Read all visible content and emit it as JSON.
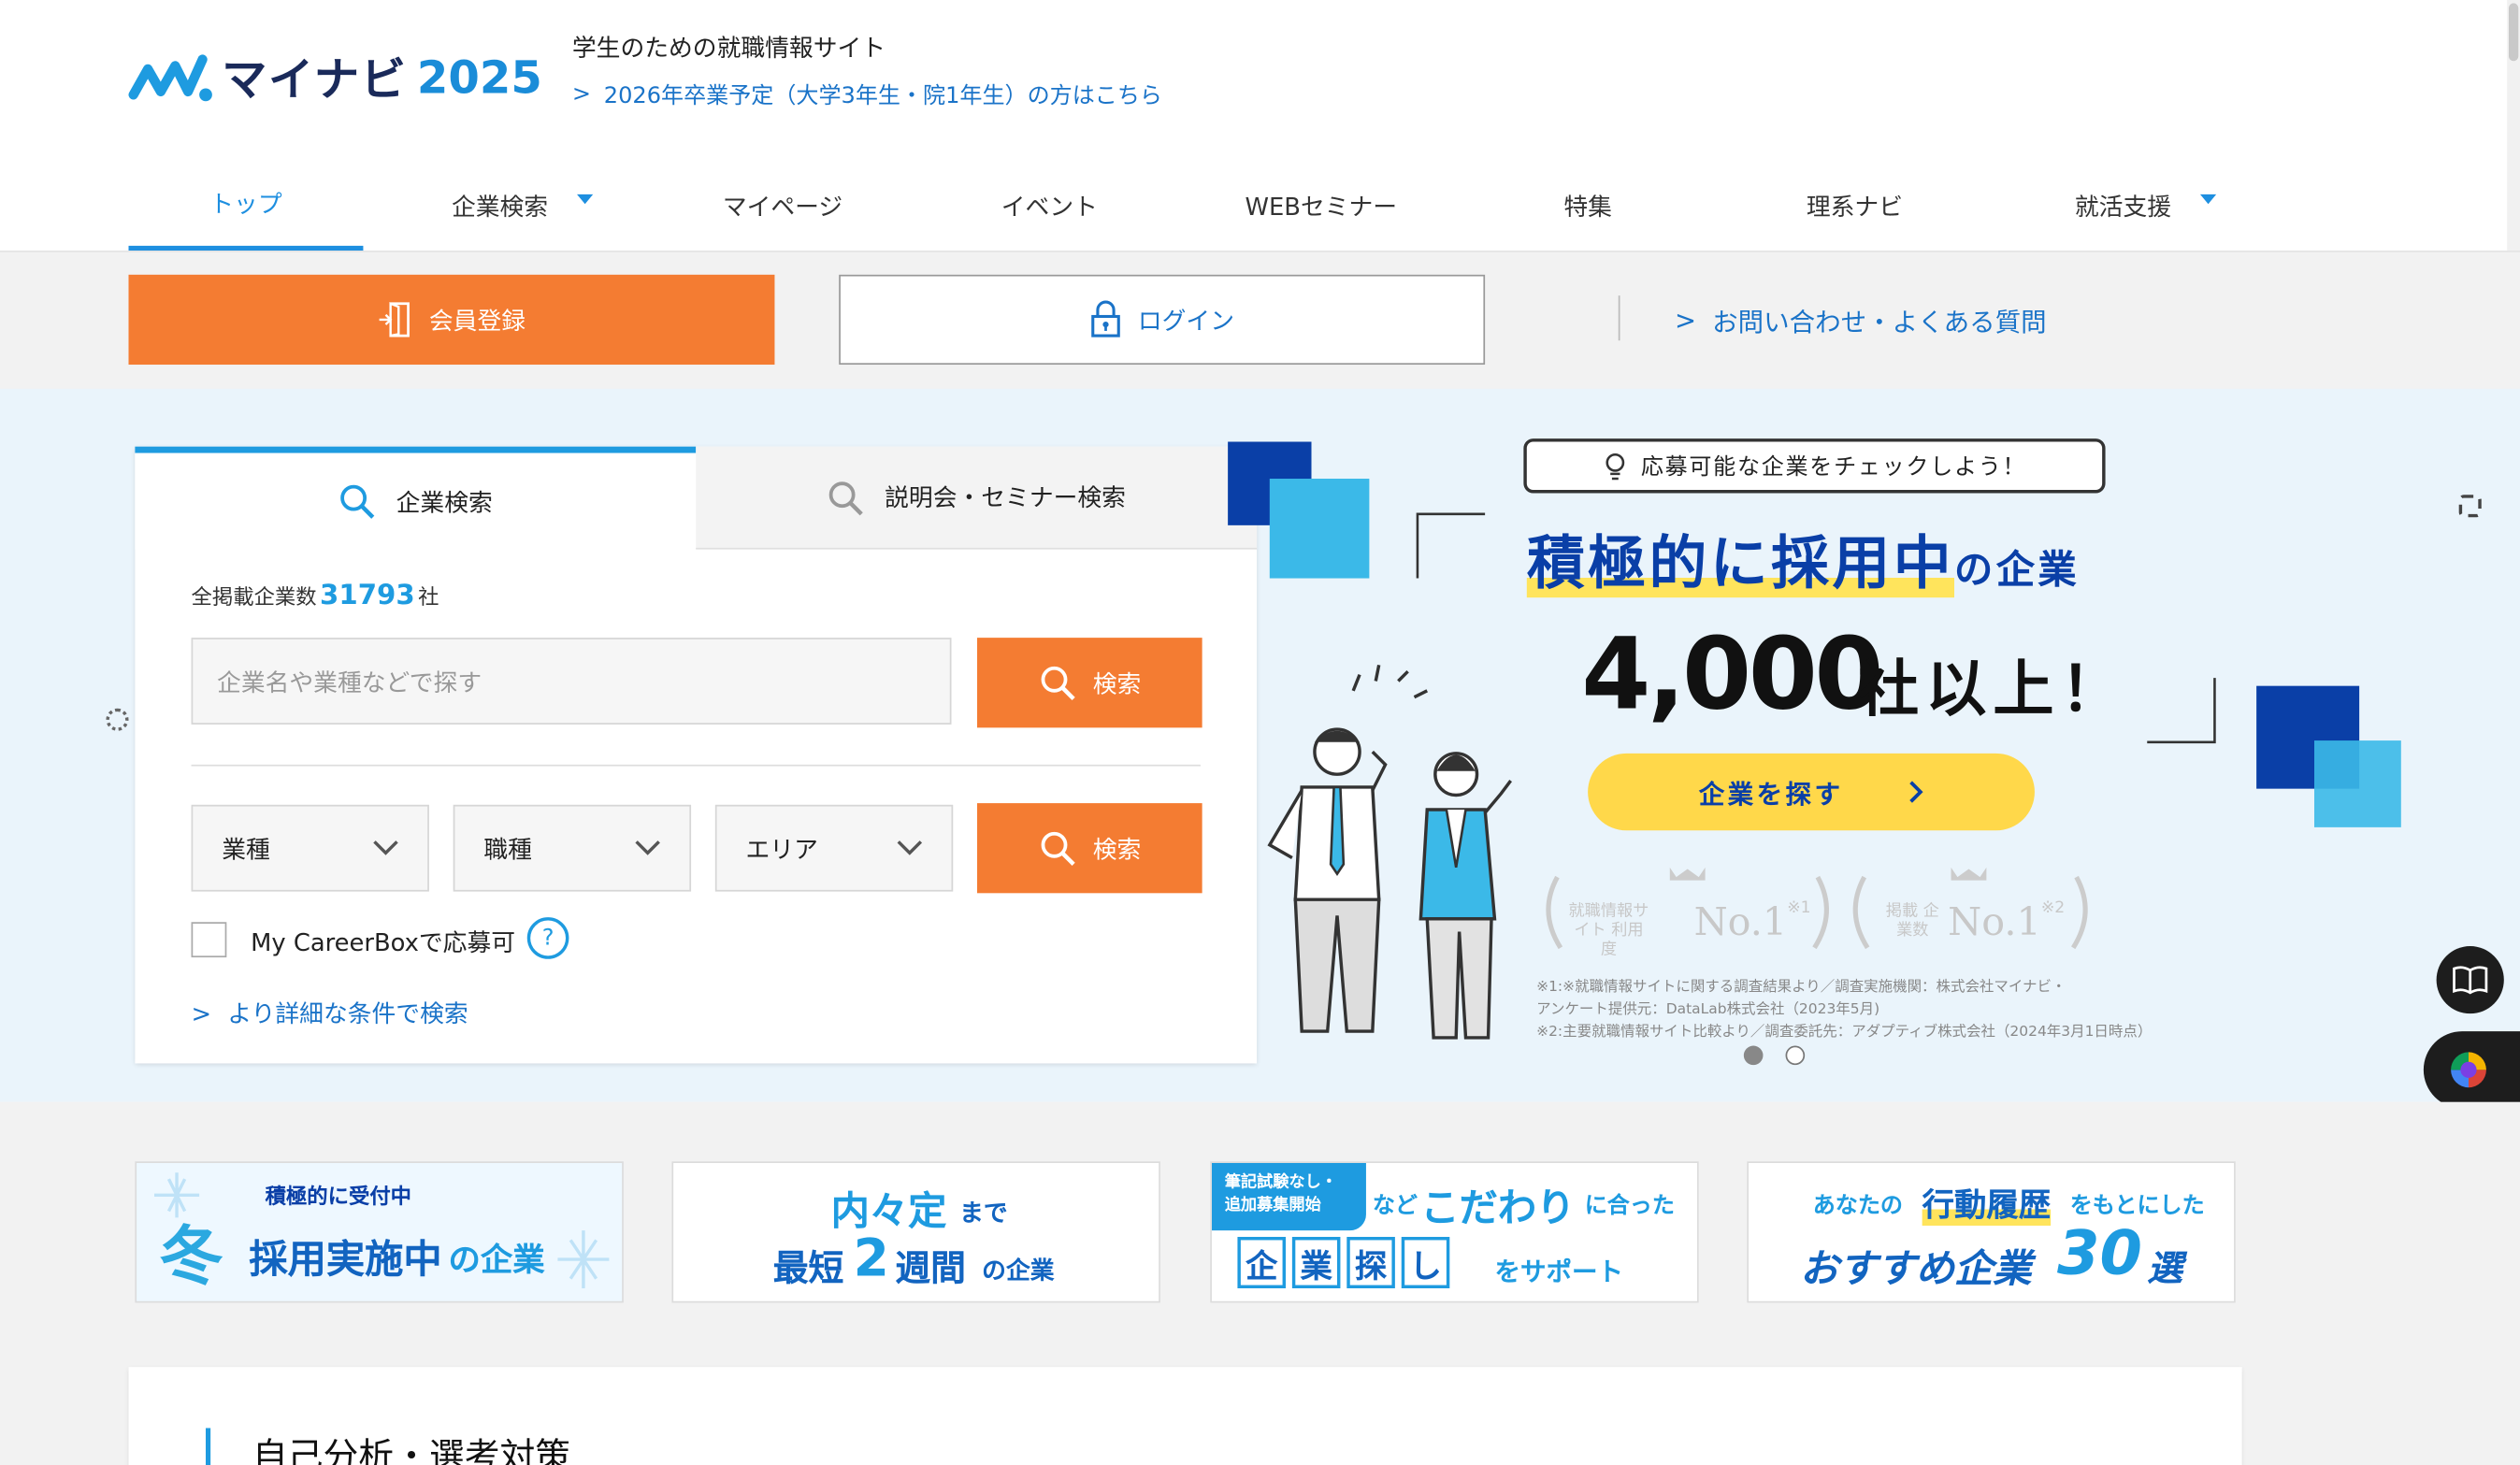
{
  "header": {
    "logo_text": "マイナビ",
    "logo_year": "2025",
    "tagline": "学生のための就職情報サイト",
    "sublink": "2026年卒業予定（大学3年生・院1年生）の方はこちら"
  },
  "nav": [
    {
      "label": "トップ"
    },
    {
      "label": "企業検索"
    },
    {
      "label": "マイページ"
    },
    {
      "label": "イベント"
    },
    {
      "label": "WEBセミナー"
    },
    {
      "label": "特集"
    },
    {
      "label": "理系ナビ"
    },
    {
      "label": "就活支援"
    }
  ],
  "actions": {
    "register": "会員登録",
    "login": "ログイン",
    "help": "お問い合わせ・よくある質問"
  },
  "search": {
    "tab_company": "企業検索",
    "tab_seminar": "説明会・セミナー検索",
    "count_label": "全掲載企業数",
    "count_value": "31793",
    "count_unit": "社",
    "keyword_placeholder": "企業名や業種などで探す",
    "search_button": "検索",
    "select_industry": "業種",
    "select_job": "職種",
    "select_area": "エリア",
    "careerbox_label": "My CareerBoxで応募可",
    "help_mark": "?",
    "detail_link": "より詳細な条件で検索"
  },
  "banner": {
    "speech": "応募可能な企業をチェックしよう！",
    "headline_highlight": "積極的に採用中",
    "headline_suffix": "の企業",
    "number": "4,000",
    "number_suffix": "社以上！",
    "cta": "企業を探す",
    "award1_label": "就職情報サイト 利用度",
    "award1_rank": "No.1",
    "award1_mark": "※1",
    "award2_label": "掲載 企業数",
    "award2_rank": "No.1",
    "award2_mark": "※2",
    "note1": "※1:※就職情報サイトに関する調査結果より／調査実施機関：株式会社マイナビ・",
    "note1b": "アンケート提供元：DataLab株式会社（2023年5月)",
    "note2": "※2:主要就職情報サイト比較より／調査委託先：アダプティブ株式会社（2024年3月1日時点）"
  },
  "cards": {
    "c1_top": "積極的に受付中",
    "c1_main": "冬",
    "c1_rest": "採用実施中",
    "c1_tail": "の企業",
    "c2_a": "内々定",
    "c2_b": "まで",
    "c2_c": "最短",
    "c2_d": "2",
    "c2_e": "週間",
    "c2_f": "の企業",
    "c3_badge1": "筆記試験なし・",
    "c3_badge2": "追加募集開始",
    "c3_a": "など",
    "c3_b": "こだわり",
    "c3_c": "に合った",
    "c3_d1": "企",
    "c3_d2": "業",
    "c3_d3": "探",
    "c3_d4": "し",
    "c3_e": "をサポート",
    "c4_a": "あなたの",
    "c4_b": "行動履歴",
    "c4_c": "をもとにした",
    "c4_d": "おすすめ企業",
    "c4_e": "30",
    "c4_f": "選"
  },
  "section": {
    "title": "自己分析・選考対策"
  },
  "colors": {
    "accent_orange": "#f47c32",
    "brand_blue": "#1e9be0",
    "banner_navy": "#0a3fa7",
    "cta_yellow": "#ffd84a"
  }
}
